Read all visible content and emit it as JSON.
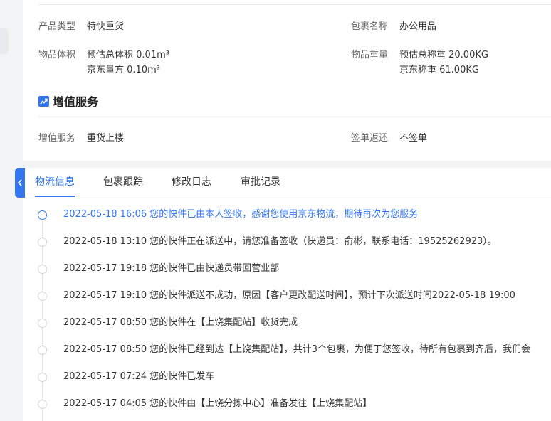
{
  "details": {
    "product_type": {
      "label": "产品类型",
      "value": "特快重货"
    },
    "package_name": {
      "label": "包裹名称",
      "value": "办公用品"
    },
    "volume": {
      "label": "物品体积",
      "lines": [
        "预估总体积 0.01m³",
        "京东量方 0.10m³"
      ]
    },
    "weight": {
      "label": "物品重量",
      "lines": [
        "预估总称重 20.00KG",
        "京东称重 61.00KG"
      ]
    }
  },
  "value_added": {
    "title": "增值服务",
    "service": {
      "label": "增值服务",
      "value": "重货上楼"
    },
    "sign_return": {
      "label": "签单返还",
      "value": "不签单"
    }
  },
  "tabs": [
    {
      "label": "物流信息",
      "active": true
    },
    {
      "label": "包裹跟踪",
      "active": false
    },
    {
      "label": "修改日志",
      "active": false
    },
    {
      "label": "审批记录",
      "active": false
    }
  ],
  "timeline": [
    "2022-05-18 16:06 您的快件已由本人签收，感谢您使用京东物流，期待再次为您服务",
    "2022-05-18 13:10 您的快件正在派送中，请您准备签收（快递员：俞彬，联系电话：19525262923）。",
    "2022-05-17 19:18 您的快件已由快递员带回营业部",
    "2022-05-17 19:10 您的快件派送不成功，原因【客户更改配送时间】，预计下次派送时间2022-05-18 19:00",
    "2022-05-17 08:50 您的快件在【上饶集配站】收货完成",
    "2022-05-17 08:50 您的快件已经到达【上饶集配站】，共计3个包裹，为便于您签收，待所有包裹到齐后，我们会",
    "2022-05-17 07:24 您的快件已发车",
    "2022-05-17 04:05 您的快件由【上饶分拣中心】准备发往【上饶集配站】"
  ],
  "colors": {
    "accent": "#3476f0"
  }
}
